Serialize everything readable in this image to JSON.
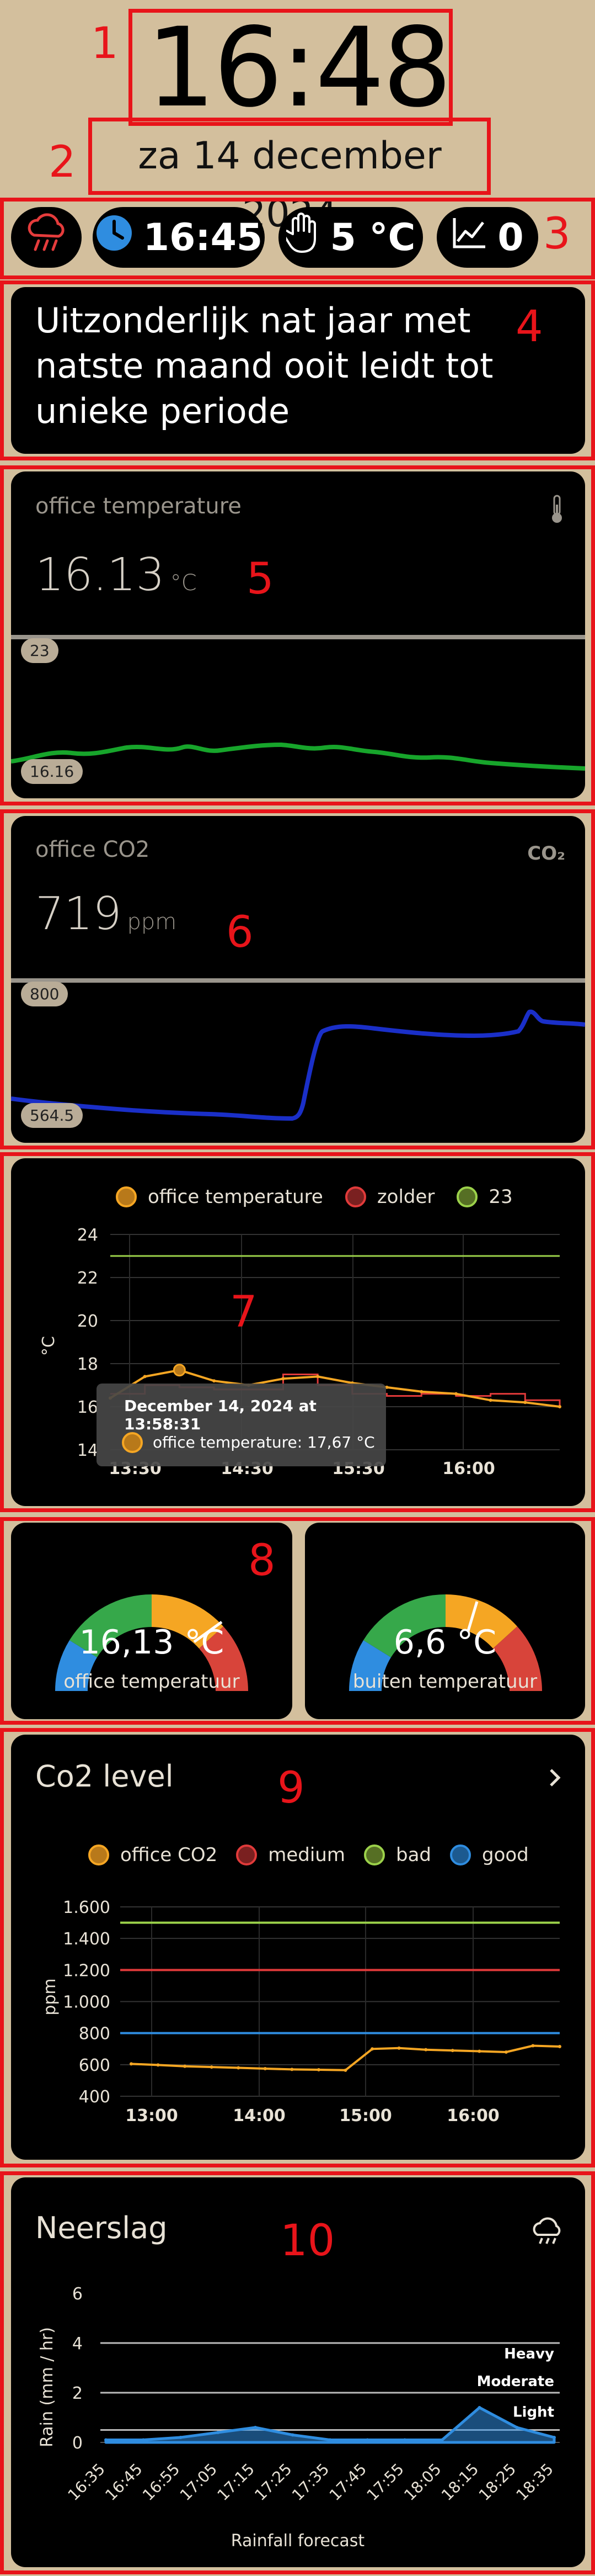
{
  "annotations": [
    "1",
    "2",
    "3",
    "4",
    "5",
    "6",
    "7",
    "8",
    "9",
    "10"
  ],
  "clock": {
    "time": "16:48",
    "date": "za 14 december 2024"
  },
  "status_bar": {
    "rain_icon": "rain-cloud-icon",
    "time_pill": "16:45",
    "temp_pill": "5 °C",
    "chart_pill": "0"
  },
  "news": {
    "headline": "Uitzonderlijk nat jaar met natste maand ooit leidt tot unieke periode"
  },
  "office_temperature_card": {
    "title": "office temperature",
    "value": "16.13",
    "unit": "°C",
    "max_chip": "23",
    "min_chip": "16.16",
    "line_color": "#17a52b"
  },
  "office_co2_card": {
    "title": "office CO2",
    "value": "719",
    "unit": "ppm",
    "badge": "CO₂",
    "max_chip": "800",
    "min_chip": "564.5",
    "line_color": "#1a2fc8"
  },
  "temp_chart": {
    "legend": [
      "office temperature",
      "zolder",
      "23"
    ],
    "legend_colors": [
      "#f5a623",
      "#e03a3a",
      "#9bd14a"
    ],
    "yticks": [
      "24",
      "22",
      "20",
      "18",
      "16",
      "14"
    ],
    "ylabel": "°C",
    "xticks": [
      "13:30",
      "14:30",
      "15:30",
      "16:00"
    ],
    "tooltip_title": "December 14, 2024 at 13:58:31",
    "tooltip_value": "office temperature: 17,67 °C"
  },
  "gauges": [
    {
      "value": "16,13 °C",
      "label": "office temperatuur",
      "fraction": 0.8
    },
    {
      "value": "6,6 °C",
      "label": "buiten temperatuur",
      "fraction": 0.62
    }
  ],
  "co2_level": {
    "title": "Co2 level",
    "legend": [
      "office CO2",
      "medium",
      "bad",
      "good"
    ],
    "legend_colors": [
      "#f5a623",
      "#e03a3a",
      "#9bd14a",
      "#2f8de0"
    ],
    "yticks": [
      "1.600",
      "1.400",
      "1.200",
      "1.000",
      "800",
      "600",
      "400"
    ],
    "ylabel": "ppm",
    "xticks": [
      "13:00",
      "14:00",
      "15:00",
      "16:00"
    ]
  },
  "neerslag": {
    "title": "Neerslag",
    "yticks": [
      "6",
      "4",
      "2",
      "0"
    ],
    "ylabel": "Rain (mm / hr)",
    "levels": [
      "Heavy",
      "Moderate",
      "Light"
    ],
    "xticks": [
      "16:35",
      "16:45",
      "16:55",
      "17:05",
      "17:15",
      "17:25",
      "17:35",
      "17:45",
      "17:55",
      "18:05",
      "18:15",
      "18:25",
      "18:35"
    ],
    "xlabel": "Rainfall forecast"
  },
  "chart_data": [
    {
      "type": "line",
      "title": "",
      "ylabel": "°C",
      "ylim": [
        14,
        24
      ],
      "series": [
        {
          "name": "office temperature",
          "values": [
            16.4,
            17.4,
            17.7,
            17.2,
            17.0,
            17.3,
            17.4,
            17.1,
            16.9,
            16.7,
            16.6,
            16.3,
            16.2,
            16.0
          ]
        },
        {
          "name": "zolder",
          "values": [
            16.6,
            17.0,
            16.9,
            16.8,
            16.8,
            17.5,
            17.0,
            16.6,
            16.5,
            16.6,
            16.5,
            16.6,
            16.3,
            16.0
          ]
        },
        {
          "name": "23",
          "values": [
            23,
            23,
            23,
            23,
            23,
            23,
            23,
            23,
            23,
            23,
            23,
            23,
            23,
            23
          ]
        }
      ]
    },
    {
      "type": "line",
      "title": "Co2 level",
      "ylabel": "ppm",
      "ylim": [
        400,
        1600
      ],
      "series": [
        {
          "name": "office CO2",
          "values": [
            605,
            598,
            590,
            585,
            580,
            575,
            570,
            568,
            565,
            700,
            705,
            695,
            690,
            685,
            680,
            720,
            715
          ]
        },
        {
          "name": "medium",
          "values": [
            1200,
            1200
          ]
        },
        {
          "name": "bad",
          "values": [
            1500,
            1500
          ]
        },
        {
          "name": "good",
          "values": [
            800,
            800
          ]
        }
      ]
    },
    {
      "type": "area",
      "title": "",
      "xlabel": "Rainfall forecast",
      "ylabel": "Rain (mm / hr)",
      "ylim": [
        0,
        6
      ],
      "categories": [
        "16:35",
        "16:45",
        "16:55",
        "17:05",
        "17:15",
        "17:25",
        "17:35",
        "17:45",
        "17:55",
        "18:05",
        "18:15",
        "18:25",
        "18:35"
      ],
      "values": [
        0.1,
        0.1,
        0.2,
        0.4,
        0.6,
        0.3,
        0.1,
        0.1,
        0.1,
        0.1,
        1.4,
        0.6,
        0.2
      ]
    }
  ]
}
